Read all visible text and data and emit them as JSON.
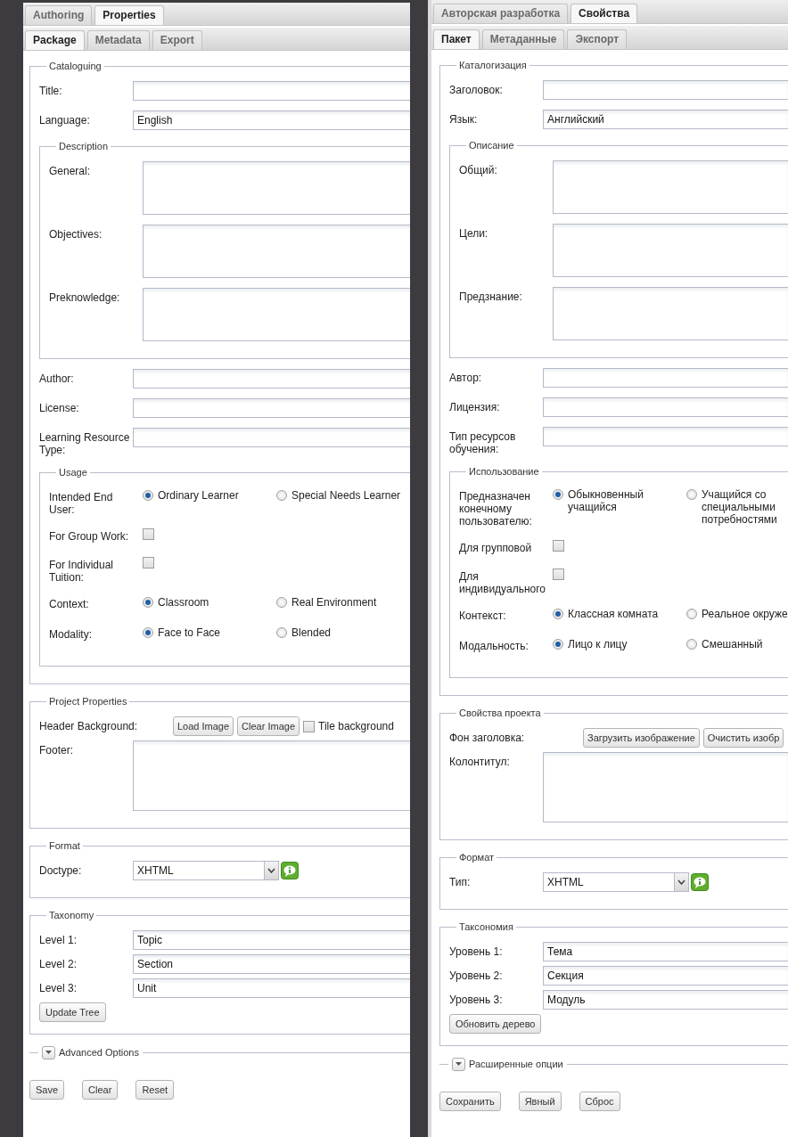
{
  "panels": [
    {
      "top_tabs": [
        {
          "label": "Authoring",
          "selected": false
        },
        {
          "label": "Properties",
          "selected": true
        }
      ],
      "sub_tabs": [
        {
          "label": "Package",
          "selected": true
        },
        {
          "label": "Metadata",
          "selected": false
        },
        {
          "label": "Export",
          "selected": false
        }
      ],
      "sections": [
        {
          "kind": "fieldset",
          "legend": "Cataloguing",
          "rows": [
            {
              "kind": "input",
              "label": "Title:"
            },
            {
              "kind": "input",
              "label": "Language:",
              "value": "English"
            },
            {
              "kind": "fieldset",
              "legend": "Description",
              "rows": [
                {
                  "kind": "textarea",
                  "label": "General:"
                },
                {
                  "kind": "textarea",
                  "label": "Objectives:"
                },
                {
                  "kind": "textarea",
                  "label": "Preknowledge:"
                }
              ]
            },
            {
              "kind": "input",
              "label": "Author:"
            },
            {
              "kind": "input",
              "label": "License:"
            },
            {
              "kind": "input",
              "label": "Learning Resource Type:"
            },
            {
              "kind": "fieldset",
              "legend": "Usage",
              "rows": [
                {
                  "kind": "radios",
                  "label": "Intended End User:",
                  "options": [
                    {
                      "label": "Ordinary Learner",
                      "selected": true
                    },
                    {
                      "label": "Special Needs Learner",
                      "selected": false
                    }
                  ]
                },
                {
                  "kind": "checkbox",
                  "label": "For Group Work:",
                  "checked": false
                },
                {
                  "kind": "checkbox",
                  "label": "For Individual Tuition:",
                  "checked": false
                },
                {
                  "kind": "radios",
                  "label": "Context:",
                  "options": [
                    {
                      "label": "Classroom",
                      "selected": true
                    },
                    {
                      "label": "Real Environment",
                      "selected": false
                    }
                  ]
                },
                {
                  "kind": "radios",
                  "label": "Modality:",
                  "options": [
                    {
                      "label": "Face to Face",
                      "selected": true
                    },
                    {
                      "label": "Blended",
                      "selected": false
                    }
                  ]
                }
              ]
            }
          ]
        },
        {
          "kind": "fieldset",
          "legend": "Project Properties",
          "rows": [
            {
              "kind": "image",
              "label": "Header Background:",
              "buttons": [
                "Load Image",
                "Clear Image"
              ],
              "tile": {
                "label": "Tile background",
                "checked": false
              }
            },
            {
              "kind": "textarea",
              "label": "Footer:"
            }
          ]
        },
        {
          "kind": "fieldset",
          "legend": "Format",
          "rows": [
            {
              "kind": "select",
              "label": "Doctype:",
              "value": "XHTML"
            }
          ]
        },
        {
          "kind": "fieldset",
          "legend": "Taxonomy",
          "rows": [
            {
              "kind": "input",
              "label": "Level 1:",
              "value": "Topic"
            },
            {
              "kind": "input",
              "label": "Level 2:",
              "value": "Section"
            },
            {
              "kind": "input",
              "label": "Level 3:",
              "value": "Unit"
            },
            {
              "kind": "button",
              "label": "Update Tree"
            }
          ]
        },
        {
          "kind": "collapsed",
          "legend": "Advanced Options",
          "expanded": false
        }
      ],
      "buttons": [
        "Save",
        "Clear",
        "Reset"
      ]
    },
    {
      "top_tabs": [
        {
          "label": "Авторская разработка",
          "selected": false
        },
        {
          "label": "Свойства",
          "selected": true
        }
      ],
      "sub_tabs": [
        {
          "label": "Пакет",
          "selected": true
        },
        {
          "label": "Метаданные",
          "selected": false
        },
        {
          "label": "Экспорт",
          "selected": false
        }
      ],
      "sections": [
        {
          "kind": "fieldset",
          "legend": "Каталогизация",
          "rows": [
            {
              "kind": "input",
              "label": "Заголовок:"
            },
            {
              "kind": "input",
              "label": "Язык:",
              "value": "Английский"
            },
            {
              "kind": "fieldset",
              "legend": "Описание",
              "rows": [
                {
                  "kind": "textarea",
                  "label": "Общий:"
                },
                {
                  "kind": "textarea",
                  "label": "Цели:"
                },
                {
                  "kind": "textarea",
                  "label": "Предзнание:"
                }
              ]
            },
            {
              "kind": "input",
              "label": "Автор:"
            },
            {
              "kind": "input",
              "label": "Лицензия:"
            },
            {
              "kind": "input",
              "label": "Тип ресурсов обучения:"
            },
            {
              "kind": "fieldset",
              "legend": "Использование",
              "rows": [
                {
                  "kind": "radios",
                  "label": "Предназначен конечному пользователю:",
                  "options": [
                    {
                      "label": "Обыкновенный учащийся",
                      "selected": true
                    },
                    {
                      "label": "Учащийся со специальными потребностями",
                      "selected": false
                    }
                  ]
                },
                {
                  "kind": "checkbox",
                  "label": "Для групповой",
                  "checked": false
                },
                {
                  "kind": "checkbox",
                  "label": "Для индивидуального",
                  "checked": false
                },
                {
                  "kind": "radios",
                  "label": "Контекст:",
                  "options": [
                    {
                      "label": "Классная комната",
                      "selected": true
                    },
                    {
                      "label": "Реальное окруже",
                      "selected": false
                    }
                  ]
                },
                {
                  "kind": "radios",
                  "label": "Модальность:",
                  "options": [
                    {
                      "label": "Лицо к лицу",
                      "selected": true
                    },
                    {
                      "label": "Смешанный",
                      "selected": false
                    }
                  ]
                }
              ]
            }
          ]
        },
        {
          "kind": "fieldset",
          "legend": "Свойства проекта",
          "rows": [
            {
              "kind": "image",
              "label": "Фон заголовка:",
              "buttons": [
                "Загрузить изображение",
                "Очистить изобр"
              ]
            },
            {
              "kind": "textarea",
              "label": "Колонтитул:"
            }
          ]
        },
        {
          "kind": "fieldset",
          "legend": "Формат",
          "rows": [
            {
              "kind": "select",
              "label": "Тип:",
              "value": "XHTML"
            }
          ]
        },
        {
          "kind": "fieldset",
          "legend": "Таксономия",
          "rows": [
            {
              "kind": "input",
              "label": "Уровень 1:",
              "value": "Тема"
            },
            {
              "kind": "input",
              "label": "Уровень 2:",
              "value": "Секция"
            },
            {
              "kind": "input",
              "label": "Уровень 3:",
              "value": "Модуль"
            },
            {
              "kind": "button",
              "label": "Обновить дерево"
            }
          ]
        },
        {
          "kind": "collapsed",
          "legend": "Расширенные опции",
          "expanded": false
        }
      ],
      "buttons": [
        "Сохранить",
        "Явный",
        "Сброс"
      ]
    }
  ]
}
